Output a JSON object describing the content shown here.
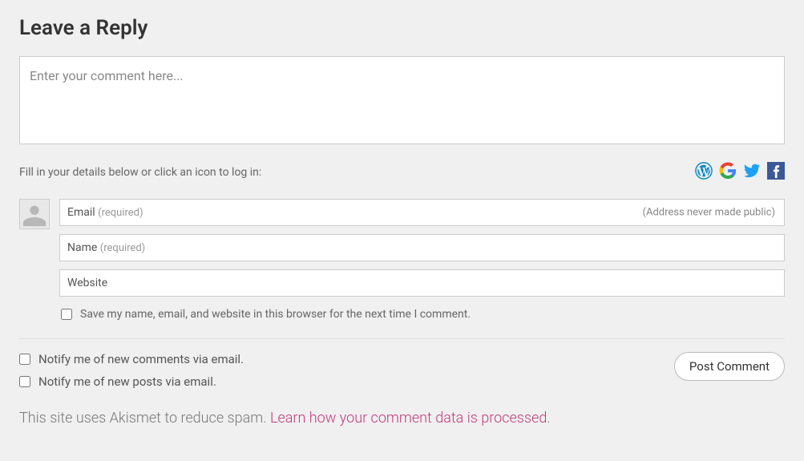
{
  "heading": "Leave a Reply",
  "comment": {
    "placeholder": "Enter your comment here...",
    "value": ""
  },
  "login_prompt": "Fill in your details below or click an icon to log in:",
  "icons": {
    "wordpress": "wordpress-icon",
    "google": "google-icon",
    "twitter": "twitter-icon",
    "facebook": "facebook-icon"
  },
  "fields": {
    "email": {
      "label": "Email",
      "required_text": "(required)",
      "hint": "(Address never made public)",
      "value": ""
    },
    "name": {
      "label": "Name",
      "required_text": "(required)",
      "value": ""
    },
    "website": {
      "label": "Website",
      "value": ""
    }
  },
  "save_info_label": "Save my name, email, and website in this browser for the next time I comment.",
  "notify": {
    "comments": "Notify me of new comments via email.",
    "posts": "Notify me of new posts via email."
  },
  "submit_label": "Post Comment",
  "akismet": {
    "prefix": "This site uses Akismet to reduce spam. ",
    "link_text": "Learn how your comment data is processed",
    "suffix": "."
  }
}
